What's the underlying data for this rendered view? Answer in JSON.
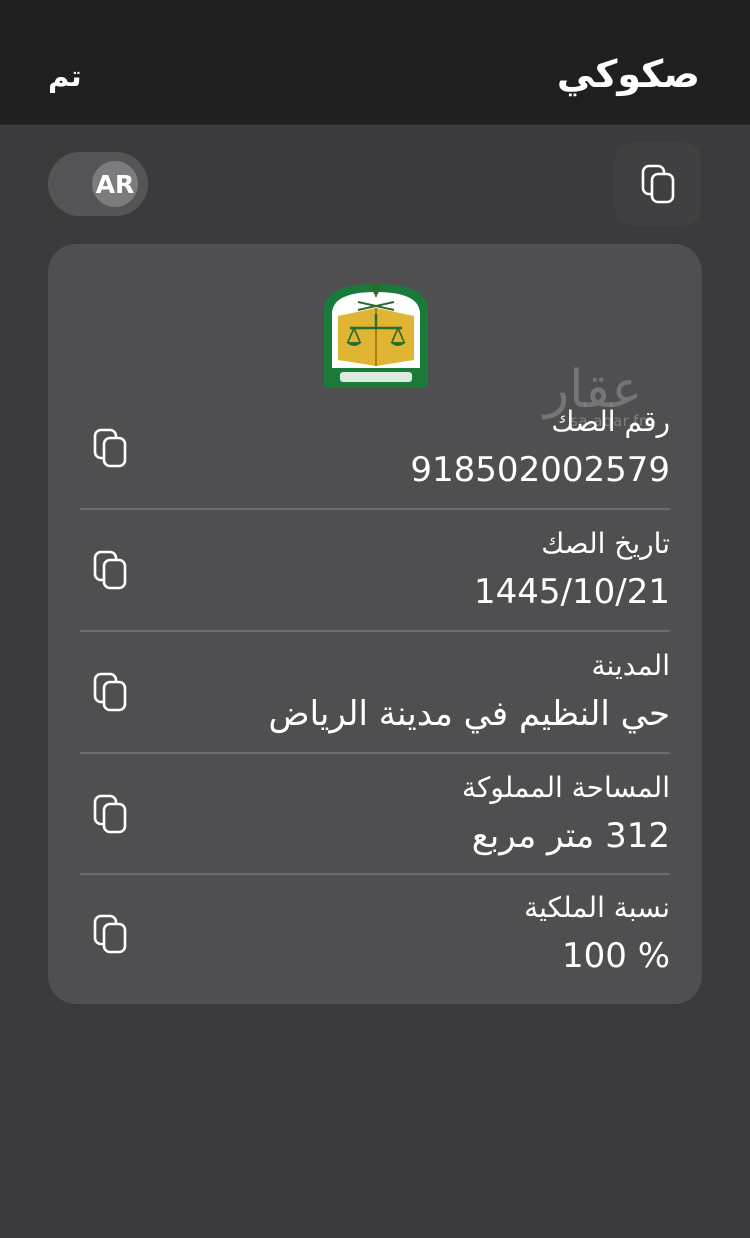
{
  "header": {
    "title": "صكوكي",
    "done_label": "تم"
  },
  "lang_toggle": {
    "label": "AR"
  },
  "watermark": {
    "text": "عقار",
    "url": "sa.aqar.fm"
  },
  "deed": {
    "emblem": "ministry-of-justice-emblem",
    "rows": [
      {
        "label": "رقم الصك",
        "value": "918502002579"
      },
      {
        "label": "تاريخ الصك",
        "value": "1445/10/21"
      },
      {
        "label": "المدينة",
        "value": "حي النظيم في  مدينة الرياض"
      },
      {
        "label": "المساحة المملوكة",
        "value": "312 متر مربع"
      },
      {
        "label": "نسبة الملكية",
        "value": "100 %"
      }
    ]
  },
  "colors": {
    "background": "#3b3b3d",
    "header": "#1f1f1f",
    "card": "#4f4f52",
    "emblem_green": "#1a7a3a",
    "emblem_gold": "#e0b533"
  },
  "icons": {
    "copy": "copy-icon"
  }
}
